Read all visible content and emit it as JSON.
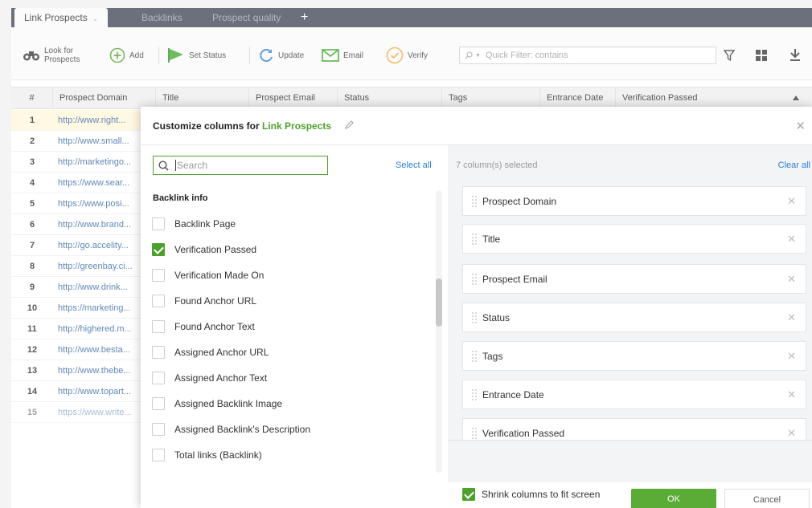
{
  "tabs": [
    {
      "label": "Link Prospects"
    },
    {
      "label": "Backlinks"
    },
    {
      "label": "Prospect quality"
    }
  ],
  "tab_plus": "+",
  "toolbar": {
    "look_for_1": "Look for",
    "look_for_2": "Prospects",
    "add": "Add",
    "set_status": "Set Status",
    "update": "Update",
    "email": "Email",
    "verify": "Verify",
    "quick_filter_placeholder": "Quick Filter: contains"
  },
  "grid": {
    "headers": [
      "#",
      "Prospect Domain",
      "Title",
      "Prospect Email",
      "Status",
      "Tags",
      "Entrance Date",
      "Verification Passed"
    ],
    "rows": [
      {
        "n": "1",
        "domain": "http://www.right..."
      },
      {
        "n": "2",
        "domain": "http://www.small..."
      },
      {
        "n": "3",
        "domain": "http://marketingo..."
      },
      {
        "n": "4",
        "domain": "https://www.sear..."
      },
      {
        "n": "5",
        "domain": "https://www.posi..."
      },
      {
        "n": "6",
        "domain": "http://www.brand..."
      },
      {
        "n": "7",
        "domain": "http://go.accelity..."
      },
      {
        "n": "8",
        "domain": "http://greenbay.ci..."
      },
      {
        "n": "9",
        "domain": "http://www.drink..."
      },
      {
        "n": "10",
        "domain": "https://marketing..."
      },
      {
        "n": "11",
        "domain": "http://highered.m..."
      },
      {
        "n": "12",
        "domain": "http://www.besta..."
      },
      {
        "n": "13",
        "domain": "http://www.thebe..."
      },
      {
        "n": "14",
        "domain": "http://www.topart..."
      },
      {
        "n": "15",
        "domain": "https://www.write..."
      }
    ]
  },
  "dialog": {
    "title_prefix": "Customize columns for ",
    "title_project": "Link Prospects",
    "search_placeholder": "Search",
    "select_all": "Select all",
    "group_label": "Backlink info",
    "options": [
      {
        "label": "Backlink Page",
        "checked": false
      },
      {
        "label": "Verification Passed",
        "checked": true
      },
      {
        "label": "Verification Made On",
        "checked": false
      },
      {
        "label": "Found Anchor URL",
        "checked": false
      },
      {
        "label": "Found Anchor Text",
        "checked": false
      },
      {
        "label": "Assigned Anchor URL",
        "checked": false
      },
      {
        "label": "Assigned Anchor Text",
        "checked": false
      },
      {
        "label": "Assigned Backlink Image",
        "checked": false
      },
      {
        "label": "Assigned Backlink's Description",
        "checked": false
      },
      {
        "label": "Total links (Backlink)",
        "checked": false
      }
    ],
    "selected_count": "7 column(s) selected",
    "clear_all": "Clear all",
    "selected_columns": [
      "Prospect Domain",
      "Title",
      "Prospect Email",
      "Status",
      "Tags",
      "Entrance Date",
      "Verification Passed"
    ],
    "shrink_label": "Shrink columns to fit screen",
    "shrink_checked": true,
    "ok": "OK",
    "cancel": "Cancel"
  },
  "colors": {
    "accent": "#4ea02d",
    "link": "#2b7fd6",
    "tabbar": "#3b4150"
  }
}
